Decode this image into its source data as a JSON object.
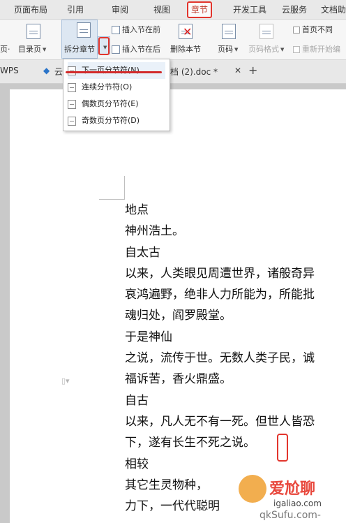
{
  "tabs": [
    "页面布局",
    "引用",
    "审阅",
    "视图",
    "章节",
    "开发工具",
    "云服务",
    "文档助"
  ],
  "ribbon": {
    "left_cut": "页·",
    "toc_page": "目录页",
    "split_chapter": "拆分章节",
    "insert_before": "插入节在前",
    "insert_after": "插入节在后",
    "delete_section": "删除本节",
    "page_number": "页码",
    "page_number_format": "页码格式",
    "first_page_different": "首页不同",
    "restart_numbering": "重新开始编"
  },
  "doc_tabs": {
    "wps": "WPS",
    "cloud_cut": "云",
    "doc_name": "档 (2).doc *",
    "close": "✕",
    "add": "+"
  },
  "menu": {
    "items": [
      "下一页分节符(N)",
      "连续分节符(O)",
      "偶数页分节符(E)",
      "奇数页分节符(D)"
    ]
  },
  "document": {
    "lines": [
      "地点",
      "神州浩土。",
      "自太古",
      "以来，人类眼见周遭世界，诸般奇异",
      "哀鸿遍野，绝非人力所能为，所能批",
      "魂归处，阎罗殿堂。",
      "于是神仙",
      "之说，流传于世。无数人类子民，诚",
      "福诉苦，香火鼎盛。",
      "自古",
      "以来，凡人无不有一死。但世人皆恐",
      "下，遂有长生不死之说。",
      "相较",
      "其它生灵物种，",
      "力下，一代代聪明"
    ]
  },
  "watermark": {
    "brand": "爱尬聊",
    "site": "igaliao.com",
    "bottom": "qkSufu.com-"
  },
  "colors": {
    "highlight_red": "#e2352d",
    "ribbon_bg": "#f6f6f6",
    "page_bg": "#ffffff"
  }
}
